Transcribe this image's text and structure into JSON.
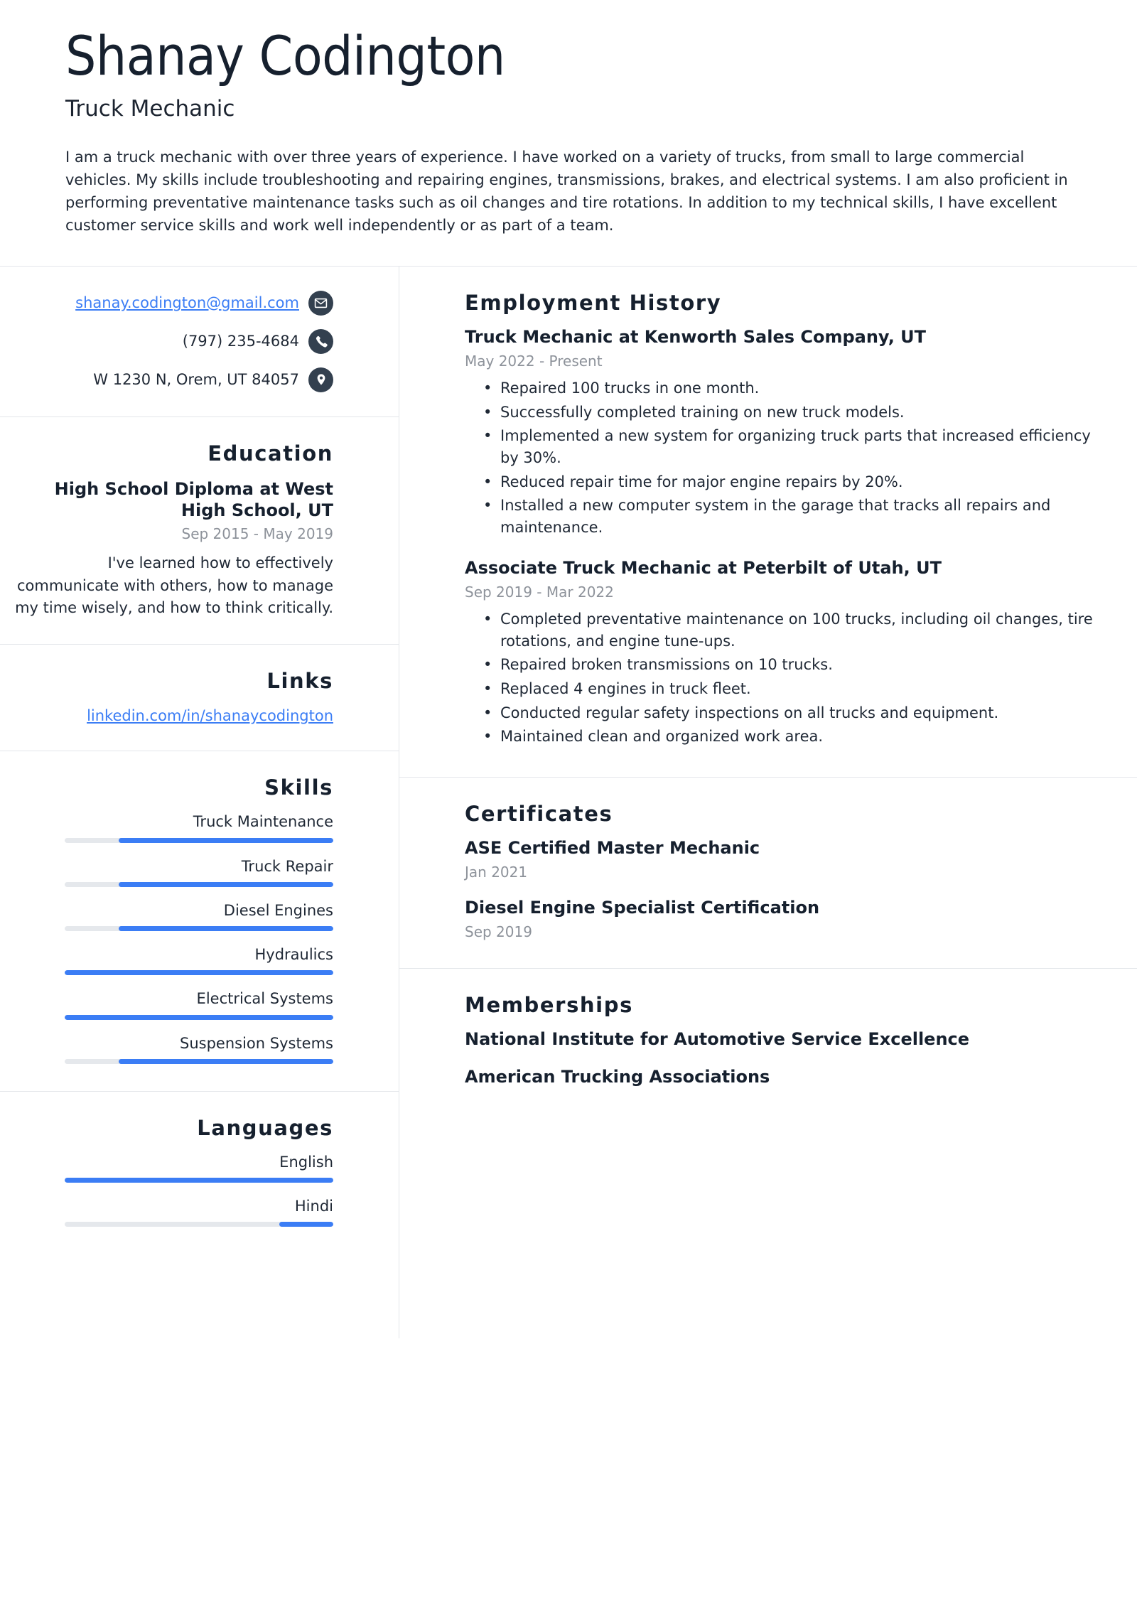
{
  "header": {
    "full_name": "Shanay Codington",
    "job_title": "Truck Mechanic",
    "summary": "I am a truck mechanic with over three years of experience. I have worked on a variety of trucks, from small to large commercial vehicles. My skills include troubleshooting and repairing engines, transmissions, brakes, and electrical systems. I am also proficient in performing preventative maintenance tasks such as oil changes and tire rotations. In addition to my technical skills, I have excellent customer service skills and work well independently or as part of a team."
  },
  "colors": {
    "accent": "#3b7df5",
    "text": "#1f2835",
    "heading": "#16202e",
    "muted": "#8d929a",
    "track": "#e5e8ec",
    "icon_circle": "#33404f",
    "rule": "#e3e6ea"
  },
  "contact": {
    "email": "shanay.codington@gmail.com",
    "email_icon": "envelope-icon",
    "phone": "(797) 235-4684",
    "phone_icon": "phone-icon",
    "address": "W 1230 N, Orem, UT 84057",
    "address_icon": "map-pin-icon"
  },
  "education": {
    "heading": "Education",
    "entries": [
      {
        "title": "High School Diploma at West High School, UT",
        "date": "Sep 2015 - May 2019",
        "description": "I've learned how to effectively communicate with others, how to manage my time wisely, and how to think critically."
      }
    ]
  },
  "links": {
    "heading": "Links",
    "items": [
      {
        "label": "linkedin.com/in/shanaycodington"
      }
    ]
  },
  "skills": {
    "heading": "Skills",
    "items": [
      {
        "label": "Truck Maintenance",
        "level": 80
      },
      {
        "label": "Truck Repair",
        "level": 80
      },
      {
        "label": "Diesel Engines",
        "level": 80
      },
      {
        "label": "Hydraulics",
        "level": 100
      },
      {
        "label": "Electrical Systems",
        "level": 100
      },
      {
        "label": "Suspension Systems",
        "level": 80
      }
    ]
  },
  "languages": {
    "heading": "Languages",
    "items": [
      {
        "label": "English",
        "level": 100
      },
      {
        "label": "Hindi",
        "level": 20
      }
    ]
  },
  "employment": {
    "heading": "Employment History",
    "jobs": [
      {
        "title": "Truck Mechanic at Kenworth Sales Company, UT",
        "date": "May 2022 - Present",
        "bullets": [
          "Repaired 100 trucks in one month.",
          "Successfully completed training on new truck models.",
          "Implemented a new system for organizing truck parts that increased efficiency by 30%.",
          "Reduced repair time for major engine repairs by 20%.",
          "Installed a new computer system in the garage that tracks all repairs and maintenance."
        ]
      },
      {
        "title": "Associate Truck Mechanic at Peterbilt of Utah, UT",
        "date": "Sep 2019 - Mar 2022",
        "bullets": [
          "Completed preventative maintenance on 100 trucks, including oil changes, tire rotations, and engine tune-ups.",
          "Repaired broken transmissions on 10 trucks.",
          "Replaced 4 engines in truck fleet.",
          "Conducted regular safety inspections on all trucks and equipment.",
          "Maintained clean and organized work area."
        ]
      }
    ]
  },
  "certificates": {
    "heading": "Certificates",
    "items": [
      {
        "title": "ASE Certified Master Mechanic",
        "date": "Jan 2021"
      },
      {
        "title": "Diesel Engine Specialist Certification",
        "date": "Sep 2019"
      }
    ]
  },
  "memberships": {
    "heading": "Memberships",
    "items": [
      {
        "title": "National Institute for Automotive Service Excellence"
      },
      {
        "title": "American Trucking Associations"
      }
    ]
  }
}
